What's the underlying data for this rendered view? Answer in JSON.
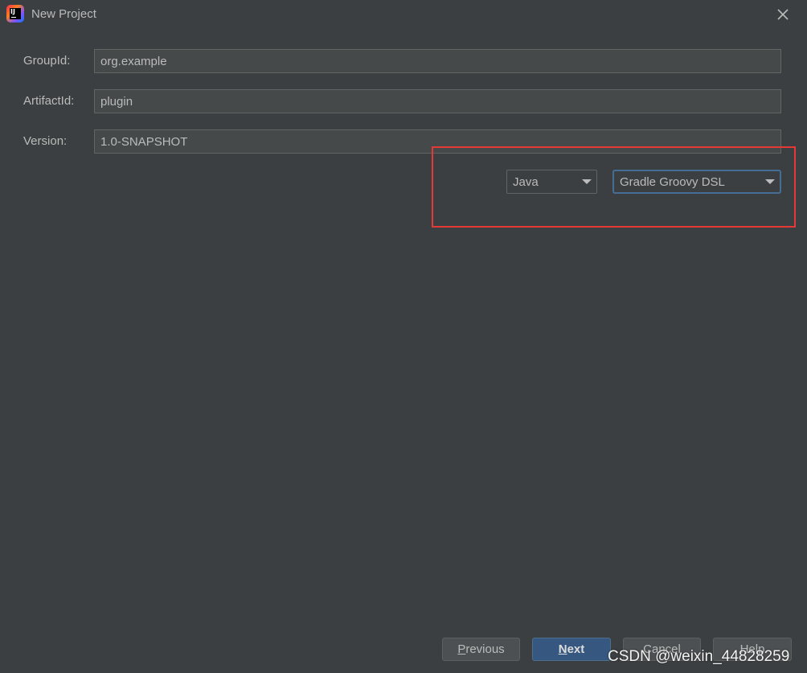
{
  "window": {
    "title": "New Project",
    "app_icon": "intellij-idea-icon",
    "close_icon": "close-icon"
  },
  "form": {
    "group_id": {
      "label": "GroupId:",
      "value": "org.example"
    },
    "artifact_id": {
      "label": "ArtifactId:",
      "value": "plugin"
    },
    "version": {
      "label": "Version:",
      "value": "1.0-SNAPSHOT"
    }
  },
  "build_options": {
    "language": {
      "selected": "Java"
    },
    "build_script": {
      "selected": "Gradle Groovy DSL"
    }
  },
  "buttons": {
    "previous": {
      "mnemonic": "P",
      "rest": "revious"
    },
    "next": {
      "mnemonic": "N",
      "rest": "ext"
    },
    "cancel": {
      "label": "Cancel"
    },
    "help": {
      "label": "Help"
    }
  },
  "watermark": "CSDN @weixin_44828259",
  "colors": {
    "background": "#3c3f41",
    "input_background": "#45494a",
    "primary_button": "#365880",
    "highlight_box": "#e53935",
    "focus_border": "#466d94"
  }
}
